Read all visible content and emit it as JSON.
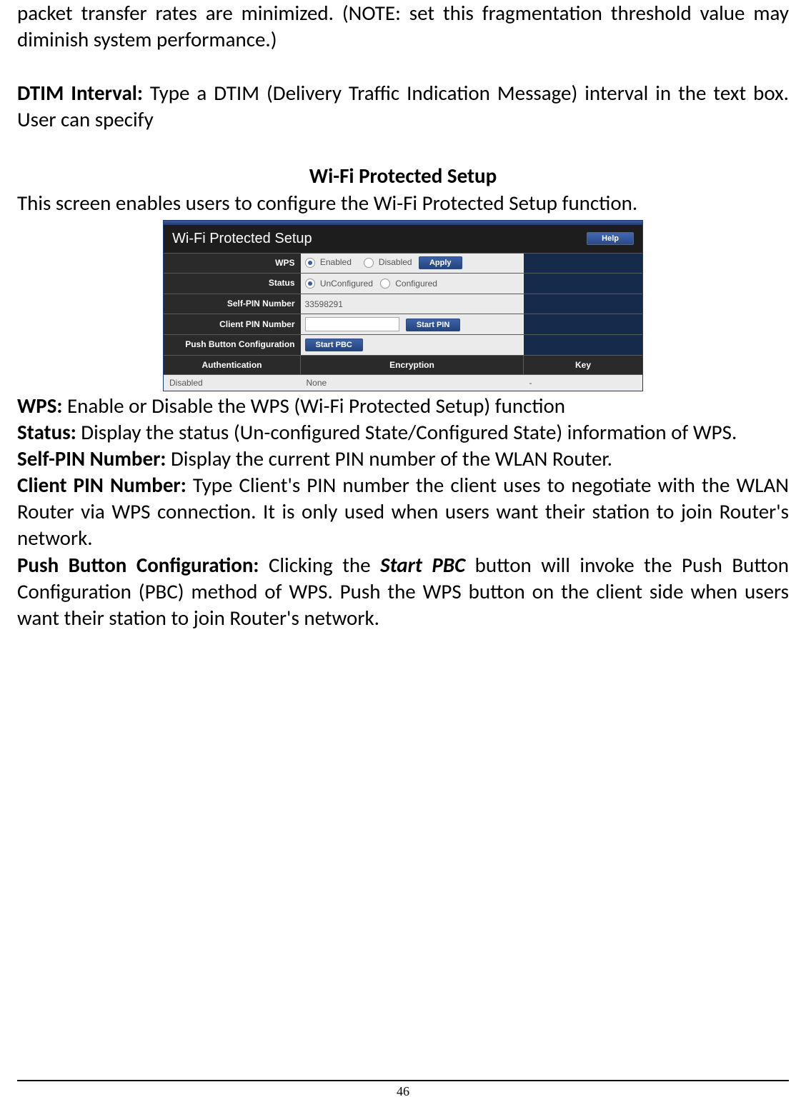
{
  "para1": "packet transfer rates are minimized. (NOTE: set this fragmentation threshold value may diminish system performance.)",
  "dtim_label": "DTIM Interval:",
  "dtim_text": " Type a DTIM (Delivery Traffic Indication Message) interval in the text box. User can specify",
  "section_heading": "Wi-Fi Protected Setup",
  "section_intro": "This screen enables users to configure the Wi-Fi Protected Setup function.",
  "router": {
    "title": "Wi-Fi Protected Setup",
    "help": "Help",
    "rows": {
      "wps_label": "WPS",
      "wps_enabled": "Enabled",
      "wps_disabled": "Disabled",
      "apply": "Apply",
      "status_label": "Status",
      "status_unconfigured": "UnConfigured",
      "status_configured": "Configured",
      "selfpin_label": "Self-PIN Number",
      "selfpin_value": "33598291",
      "clientpin_label": "Client PIN Number",
      "startpin": "Start PIN",
      "pbc_label": "Push Button Configuration",
      "startpbc": "Start PBC"
    },
    "auth_head": {
      "auth": "Authentication",
      "enc": "Encryption",
      "key": "Key"
    },
    "auth_data": {
      "auth": "Disabled",
      "enc": "None",
      "key": "-"
    }
  },
  "desc": {
    "wps_b": "WPS:",
    "wps_t": " Enable or Disable the WPS (Wi-Fi Protected Setup) function",
    "status_b": "Status:",
    "status_t": " Display the status (Un-configured State/Configured State) information of WPS.",
    "selfpin_b": "Self-PIN Number:",
    "selfpin_t": " Display the current PIN number of the WLAN Router.",
    "clientpin_b": "Client PIN Number:",
    "clientpin_t": " Type Client's PIN number the client uses to negotiate with the WLAN Router via WPS connection. It is only used when users want their station to join Router's network.",
    "pbc_b": "Push Button Configuration:",
    "pbc_t1": " Clicking the ",
    "pbc_em": "Start PBC",
    "pbc_t2": " button will invoke the Push Button Configuration (PBC) method of WPS. Push the WPS button on the client side when users want their station to join Router's network."
  },
  "page_number": "46"
}
